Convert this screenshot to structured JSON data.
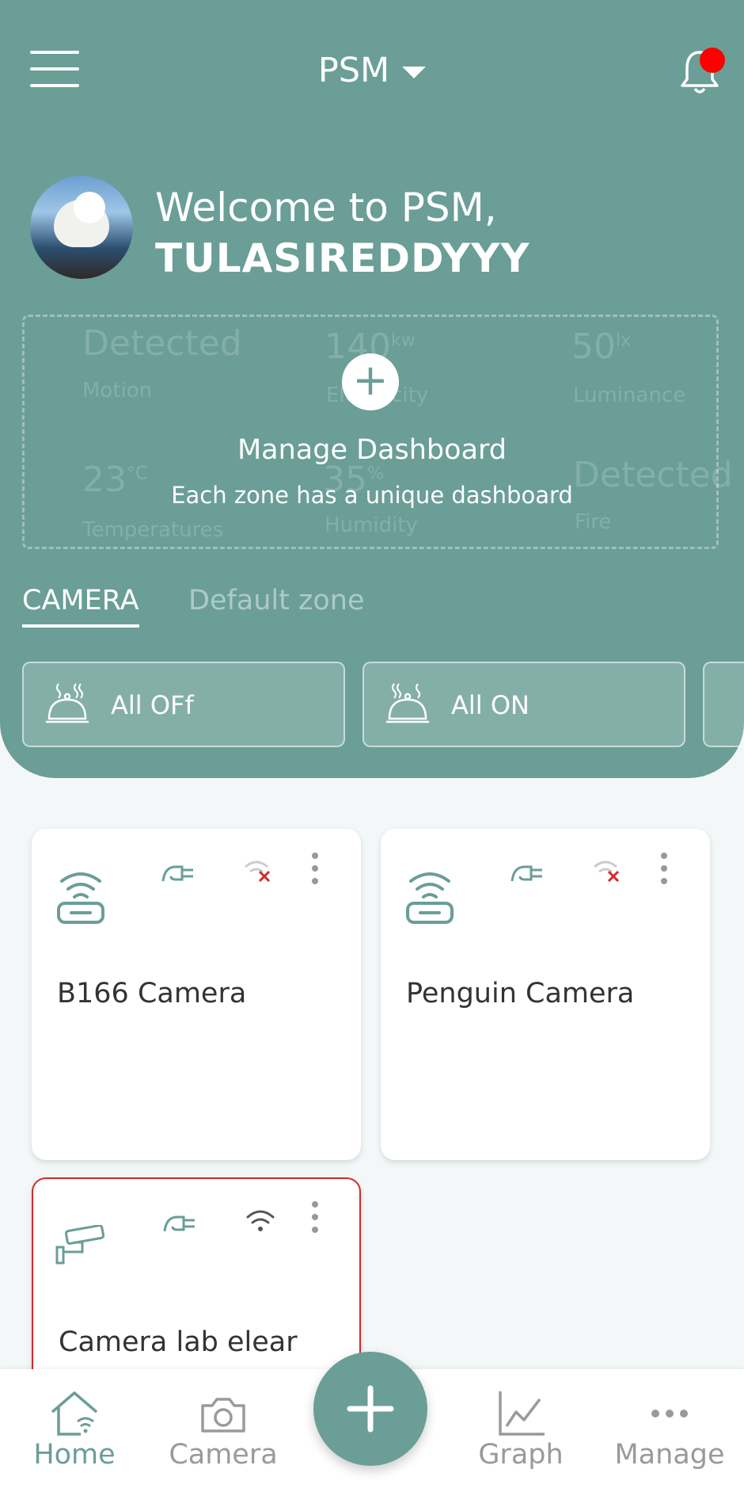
{
  "header": {
    "title": "PSM",
    "welcome_line": "Welcome to PSM,",
    "user_name": "TULASIREDDYYY"
  },
  "dashboard": {
    "manage_title": "Manage Dashboard",
    "manage_subtitle": "Each zone has a unique dashboard",
    "faint_stats": [
      {
        "value": "Detected",
        "label": "Motion"
      },
      {
        "value": "140",
        "unit": "kw",
        "label": "Electricity"
      },
      {
        "value": "50",
        "unit": "lx",
        "label": "Luminance"
      },
      {
        "value": "23",
        "unit": "°C",
        "label": "Temperatures"
      },
      {
        "value": "35",
        "unit": "%",
        "label": "Humidity"
      },
      {
        "value": "Detected",
        "label": "Fire"
      }
    ]
  },
  "tabs": [
    {
      "label": "CAMERA",
      "active": true
    },
    {
      "label": "Default zone",
      "active": false
    }
  ],
  "actions": [
    {
      "label": "All OFf"
    },
    {
      "label": "All ON"
    }
  ],
  "devices": [
    {
      "name": "B166 Camera",
      "type": "router",
      "wifi_status": "disconnected"
    },
    {
      "name": "Penguin Camera",
      "type": "router",
      "wifi_status": "disconnected"
    },
    {
      "name": "Camera lab elear",
      "type": "cctv",
      "wifi_status": "connected",
      "highlighted": true
    }
  ],
  "nav": {
    "home": "Home",
    "camera": "Camera",
    "graph": "Graph",
    "manage": "Manage"
  },
  "colors": {
    "primary": "#6a9e97",
    "alert": "#ff0000",
    "card_border_alert": "#d12a2a"
  }
}
